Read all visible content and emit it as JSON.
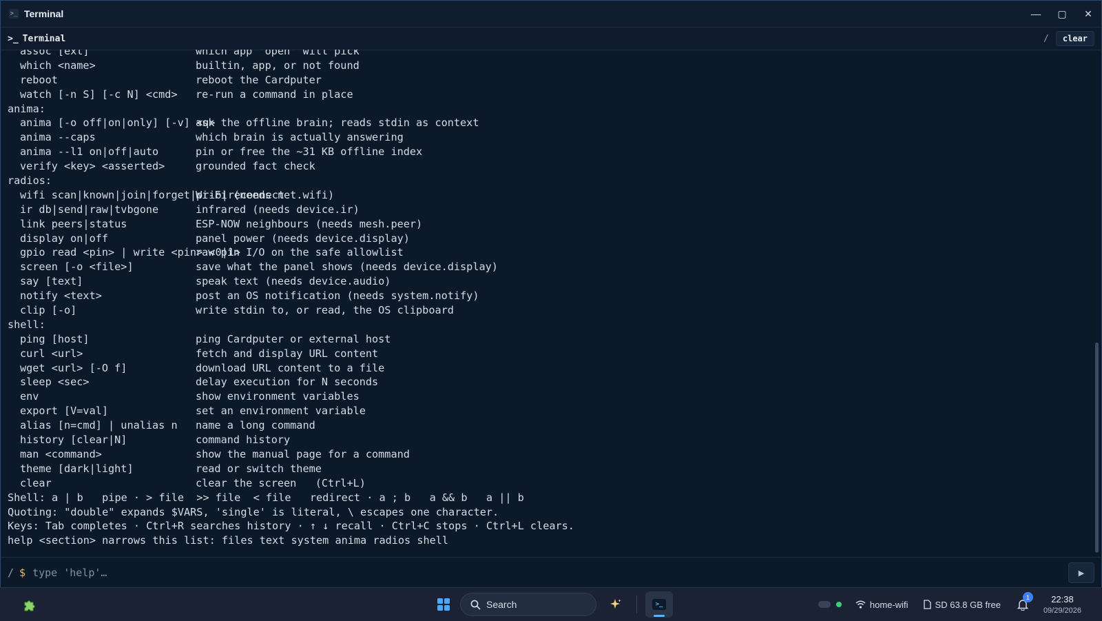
{
  "window": {
    "title": "Terminal",
    "minimize_glyph": "—",
    "maximize_glyph": "▢",
    "close_glyph": "✕"
  },
  "toolbar": {
    "prompt_icon": ">_",
    "title": "Terminal",
    "path": "/",
    "clear_label": "clear"
  },
  "output": {
    "lines": [
      {
        "type": "entry",
        "cmd": "assoc [ext]",
        "desc": "which app 'open' will pick"
      },
      {
        "type": "entry",
        "cmd": "which <name>",
        "desc": "builtin, app, or not found"
      },
      {
        "type": "entry",
        "cmd": "reboot",
        "desc": "reboot the Cardputer"
      },
      {
        "type": "entry",
        "cmd": "watch [-n S] [-c N] <cmd>",
        "desc": "re-run a command in place"
      },
      {
        "type": "header",
        "text": "anima:"
      },
      {
        "type": "entry",
        "cmd": "anima [-o off|on|only] [-v] <q>",
        "desc": "ask the offline brain; reads stdin as context"
      },
      {
        "type": "entry",
        "cmd": "anima --caps",
        "desc": "which brain is actually answering"
      },
      {
        "type": "entry",
        "cmd": "anima --l1 on|off|auto",
        "desc": "pin or free the ~31 KB offline index"
      },
      {
        "type": "entry",
        "cmd": "verify <key> <asserted>",
        "desc": "grounded fact check"
      },
      {
        "type": "header",
        "text": "radios:"
      },
      {
        "type": "entry",
        "cmd": "wifi scan|known|join|forget|prio|reconnect",
        "desc": "Wi-Fi (needs net.wifi)"
      },
      {
        "type": "entry",
        "cmd": "ir db|send|raw|tvbgone",
        "desc": "infrared (needs device.ir)"
      },
      {
        "type": "entry",
        "cmd": "link peers|status",
        "desc": "ESP-NOW neighbours (needs mesh.peer)"
      },
      {
        "type": "entry",
        "cmd": "display on|off",
        "desc": "panel power (needs device.display)"
      },
      {
        "type": "entry",
        "cmd": "gpio read <pin> | write <pin> <0|1>",
        "desc": "raw pin I/O on the safe allowlist"
      },
      {
        "type": "entry",
        "cmd": "screen [-o <file>]",
        "desc": "save what the panel shows (needs device.display)"
      },
      {
        "type": "entry",
        "cmd": "say [text]",
        "desc": "speak text (needs device.audio)"
      },
      {
        "type": "entry",
        "cmd": "notify <text>",
        "desc": "post an OS notification (needs system.notify)"
      },
      {
        "type": "entry",
        "cmd": "clip [-o]",
        "desc": "write stdin to, or read, the OS clipboard"
      },
      {
        "type": "header",
        "text": "shell:"
      },
      {
        "type": "entry",
        "cmd": "ping [host]",
        "desc": "ping Cardputer or external host"
      },
      {
        "type": "entry",
        "cmd": "curl <url>",
        "desc": "fetch and display URL content"
      },
      {
        "type": "entry",
        "cmd": "wget <url> [-O f]",
        "desc": "download URL content to a file"
      },
      {
        "type": "entry",
        "cmd": "sleep <sec>",
        "desc": "delay execution for N seconds"
      },
      {
        "type": "entry",
        "cmd": "env",
        "desc": "show environment variables"
      },
      {
        "type": "entry",
        "cmd": "export [V=val]",
        "desc": "set an environment variable"
      },
      {
        "type": "entry",
        "cmd": "alias [n=cmd] | unalias n",
        "desc": "name a long command"
      },
      {
        "type": "entry",
        "cmd": "history [clear|N]",
        "desc": "command history"
      },
      {
        "type": "entry",
        "cmd": "man <command>",
        "desc": "show the manual page for a command"
      },
      {
        "type": "entry",
        "cmd": "theme [dark|light]",
        "desc": "read or switch theme"
      },
      {
        "type": "entry",
        "cmd": "clear",
        "desc": "clear the screen   (Ctrl+L)"
      },
      {
        "type": "text",
        "text": "Shell: a | b   pipe · > file  >> file  < file   redirect · a ; b   a && b   a || b"
      },
      {
        "type": "text",
        "text": "Quoting: \"double\" expands $VARS, 'single' is literal, \\ escapes one character."
      },
      {
        "type": "text",
        "text": "Keys: Tab completes · Ctrl+R searches history · ↑ ↓ recall · Ctrl+C stops · Ctrl+L clears."
      },
      {
        "type": "text",
        "text": "help <section> narrows this list: files text system anima radios shell"
      }
    ]
  },
  "input": {
    "path": "/",
    "prompt": "$",
    "placeholder": "type 'help'…",
    "send_glyph": "▶"
  },
  "taskbar": {
    "search_label": "Search",
    "wifi_label": "home-wifi",
    "storage_label": "SD 63.8 GB free",
    "notification_count": "1",
    "time": "22:38",
    "date": "09/29/2026",
    "colors": {
      "accent": "#5bb4ff",
      "status_ok": "#39d07a",
      "badge": "#3b82f6"
    }
  }
}
